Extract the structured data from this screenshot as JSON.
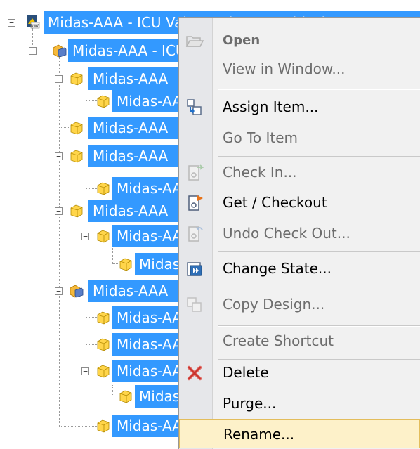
{
  "tree": {
    "nodes": [
      {
        "label": "Midas-AAA - ICU Valve Main Assembly.dwg",
        "kind": "root"
      },
      {
        "label": "Midas-AAA - ICU Valve Assy",
        "kind": "assembly"
      },
      {
        "label": "Midas-AAA",
        "kind": "part"
      },
      {
        "label": "Midas-AAA",
        "kind": "part"
      },
      {
        "label": "Midas-AAA",
        "kind": "part"
      },
      {
        "label": "Midas-AAA",
        "kind": "part"
      },
      {
        "label": "Midas-AAA",
        "kind": "part"
      },
      {
        "label": "Midas-AAA",
        "kind": "part"
      },
      {
        "label": "Midas-AAA",
        "kind": "part"
      },
      {
        "label": "Midas-AAA",
        "kind": "part"
      },
      {
        "label": "Midas-AAA",
        "kind": "assembly"
      },
      {
        "label": "Midas-AAA",
        "kind": "part"
      },
      {
        "label": "Midas-AAA",
        "kind": "part"
      },
      {
        "label": "Midas-AAA",
        "kind": "part"
      },
      {
        "label": "Midas-AAA",
        "kind": "part"
      },
      {
        "label": "Midas-AAA",
        "kind": "part"
      }
    ]
  },
  "menu": {
    "items": [
      {
        "label": "Open",
        "icon": "folder-open-icon",
        "disabled": true,
        "bold": true
      },
      {
        "label": "View in Window...",
        "disabled": true
      },
      {
        "label": "Assign Item...",
        "icon": "assign-item-icon"
      },
      {
        "label": "Go To Item",
        "disabled": true
      },
      {
        "label": "Check In...",
        "icon": "check-in-icon",
        "disabled": true
      },
      {
        "label": "Get / Checkout",
        "icon": "checkout-icon"
      },
      {
        "label": "Undo Check Out...",
        "icon": "undo-checkout-icon",
        "disabled": true
      },
      {
        "label": "Change State...",
        "icon": "change-state-icon"
      },
      {
        "label": "Copy Design...",
        "icon": "copy-design-icon",
        "disabled": true
      },
      {
        "label": "Create Shortcut",
        "disabled": true
      },
      {
        "label": "Delete",
        "icon": "delete-icon"
      },
      {
        "label": "Purge..."
      },
      {
        "label": "Rename...",
        "highlight": true
      }
    ]
  },
  "colors": {
    "selection": "#3399ff",
    "menu_bg": "#f1f1f1",
    "gutter": "#e6e7ea",
    "hover_bg": "#fdf1c9",
    "hover_border": "#e3bd5c",
    "delete_red": "#d9534f"
  }
}
